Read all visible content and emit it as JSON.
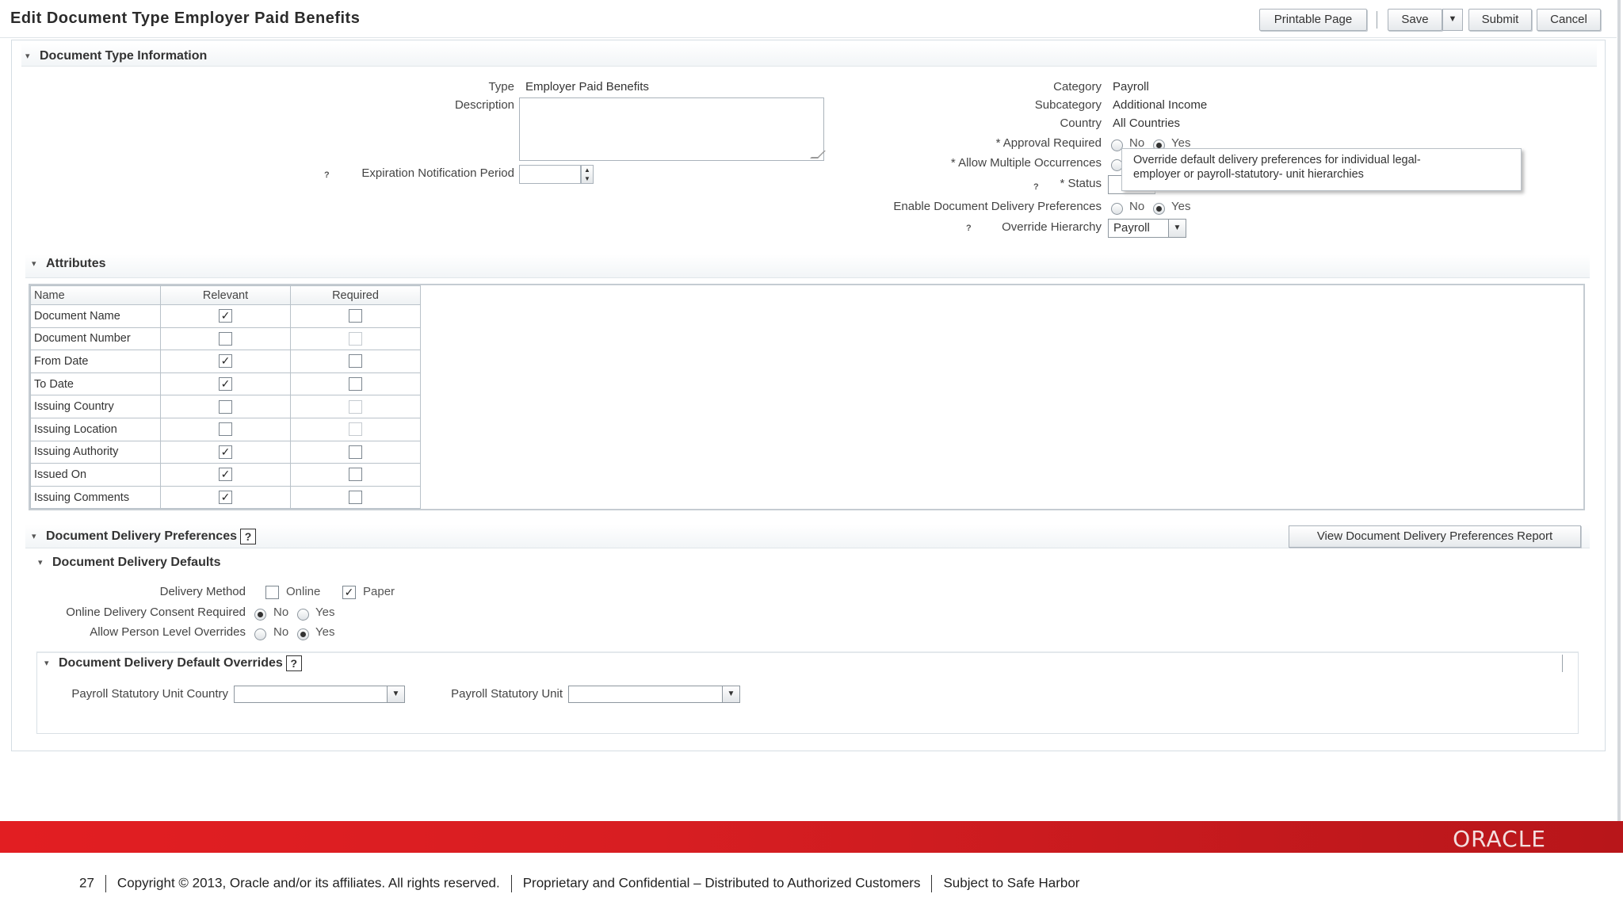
{
  "header": {
    "title": "Edit Document Type Employer Paid Benefits",
    "buttons": {
      "printable": "Printable Page",
      "save": "Save",
      "submit": "Submit",
      "cancel": "Cancel"
    }
  },
  "doc_type_info": {
    "section_title": "Document Type Information",
    "type_label": "Type",
    "type_value": "Employer Paid Benefits",
    "description_label": "Description",
    "expiration_label": "Expiration Notification Period",
    "category_label": "Category",
    "category_value": "Payroll",
    "subcategory_label": "Subcategory",
    "subcategory_value": "Additional Income",
    "country_label": "Country",
    "country_value": "All Countries",
    "approval_label": "* Approval Required",
    "multiple_label": "* Allow Multiple Occurrences",
    "status_label": "* Status",
    "enable_delivery_label": "Enable Document Delivery Preferences",
    "override_label": "Override Hierarchy",
    "override_value": "Payroll",
    "no": "No",
    "yes": "Yes",
    "tooltip_line1": "Override default delivery preferences for individual legal-",
    "tooltip_line2": "employer or payroll-statutory- unit hierarchies"
  },
  "attributes": {
    "section_title": "Attributes",
    "columns": [
      "Name",
      "Relevant",
      "Required"
    ],
    "rows": [
      {
        "name": "Document Name",
        "relevant": true,
        "required": false,
        "required_enabled": true
      },
      {
        "name": "Document Number",
        "relevant": false,
        "required": false,
        "required_enabled": false
      },
      {
        "name": "From Date",
        "relevant": true,
        "required": false,
        "required_enabled": true
      },
      {
        "name": "To Date",
        "relevant": true,
        "required": false,
        "required_enabled": true
      },
      {
        "name": "Issuing Country",
        "relevant": false,
        "required": false,
        "required_enabled": false
      },
      {
        "name": "Issuing Location",
        "relevant": false,
        "required": false,
        "required_enabled": false
      },
      {
        "name": "Issuing Authority",
        "relevant": true,
        "required": false,
        "required_enabled": true
      },
      {
        "name": "Issued On",
        "relevant": true,
        "required": false,
        "required_enabled": true
      },
      {
        "name": "Issuing Comments",
        "relevant": true,
        "required": false,
        "required_enabled": true
      }
    ]
  },
  "delivery": {
    "section_title": "Document Delivery Preferences",
    "report_button": "View Document Delivery Preferences Report",
    "defaults_title": "Document Delivery Defaults",
    "method_label": "Delivery Method",
    "online": "Online",
    "paper": "Paper",
    "consent_label": "Online Delivery Consent Required",
    "person_override_label": "Allow Person Level Overrides",
    "no": "No",
    "yes": "Yes",
    "overrides_title": "Document Delivery Default Overrides",
    "psu_country_label": "Payroll Statutory Unit Country",
    "psu_label": "Payroll Statutory Unit"
  },
  "footer": {
    "slide_number": "27",
    "copyright": "Copyright © 2013, Oracle and/or its affiliates. All rights reserved.",
    "confidential": "Proprietary and Confidential – Distributed to Authorized Customers",
    "harbor": "Subject to Safe Harbor",
    "logo": "ORACLE"
  }
}
